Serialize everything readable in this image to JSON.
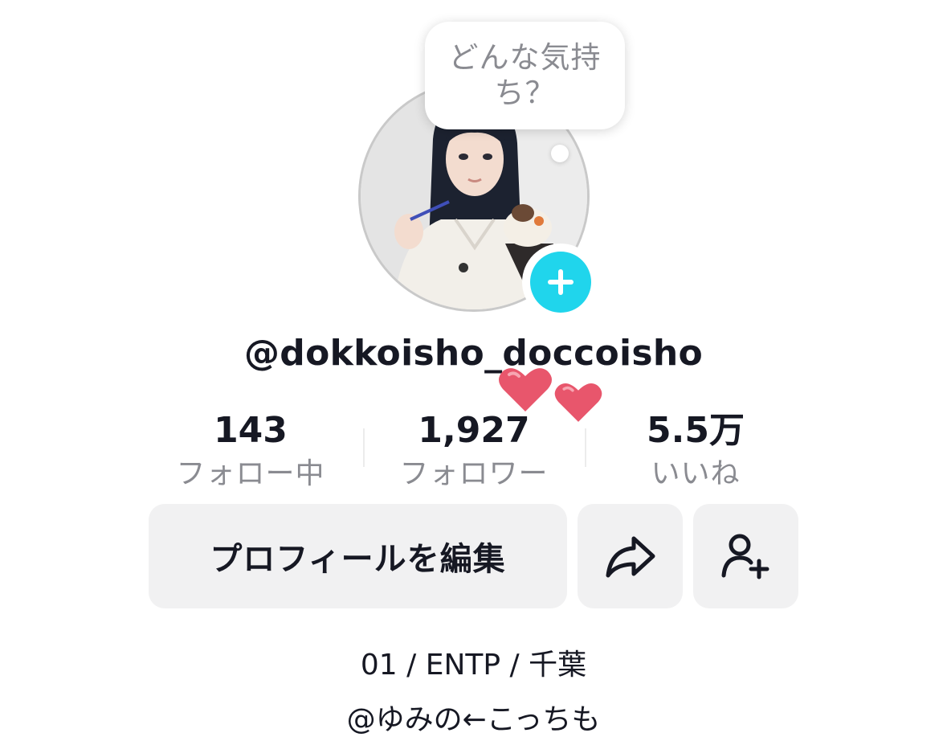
{
  "profile": {
    "mood_prompt": "どんな気持ち？",
    "username": "@dokkoisho_doccoisho",
    "avatar_alt": "avatar",
    "add_icon": "plus-icon"
  },
  "stats": {
    "following": {
      "value": "143",
      "label": "フォロー中"
    },
    "followers": {
      "value": "1,927",
      "label": "フォロワー"
    },
    "likes": {
      "value": "5.5万",
      "label": "いいね"
    }
  },
  "actions": {
    "edit_profile_label": "プロフィールを編集",
    "share_icon": "share-arrow-icon",
    "add_friend_icon": "add-person-icon"
  },
  "bio": {
    "line1": "01 / ENTP / 千葉",
    "line2": "@ゆみの←こっちも"
  },
  "colors": {
    "accent": "#20d5ec",
    "heart": "#e8566c",
    "button_bg": "#f1f1f2",
    "muted_text": "#8a8b91"
  }
}
